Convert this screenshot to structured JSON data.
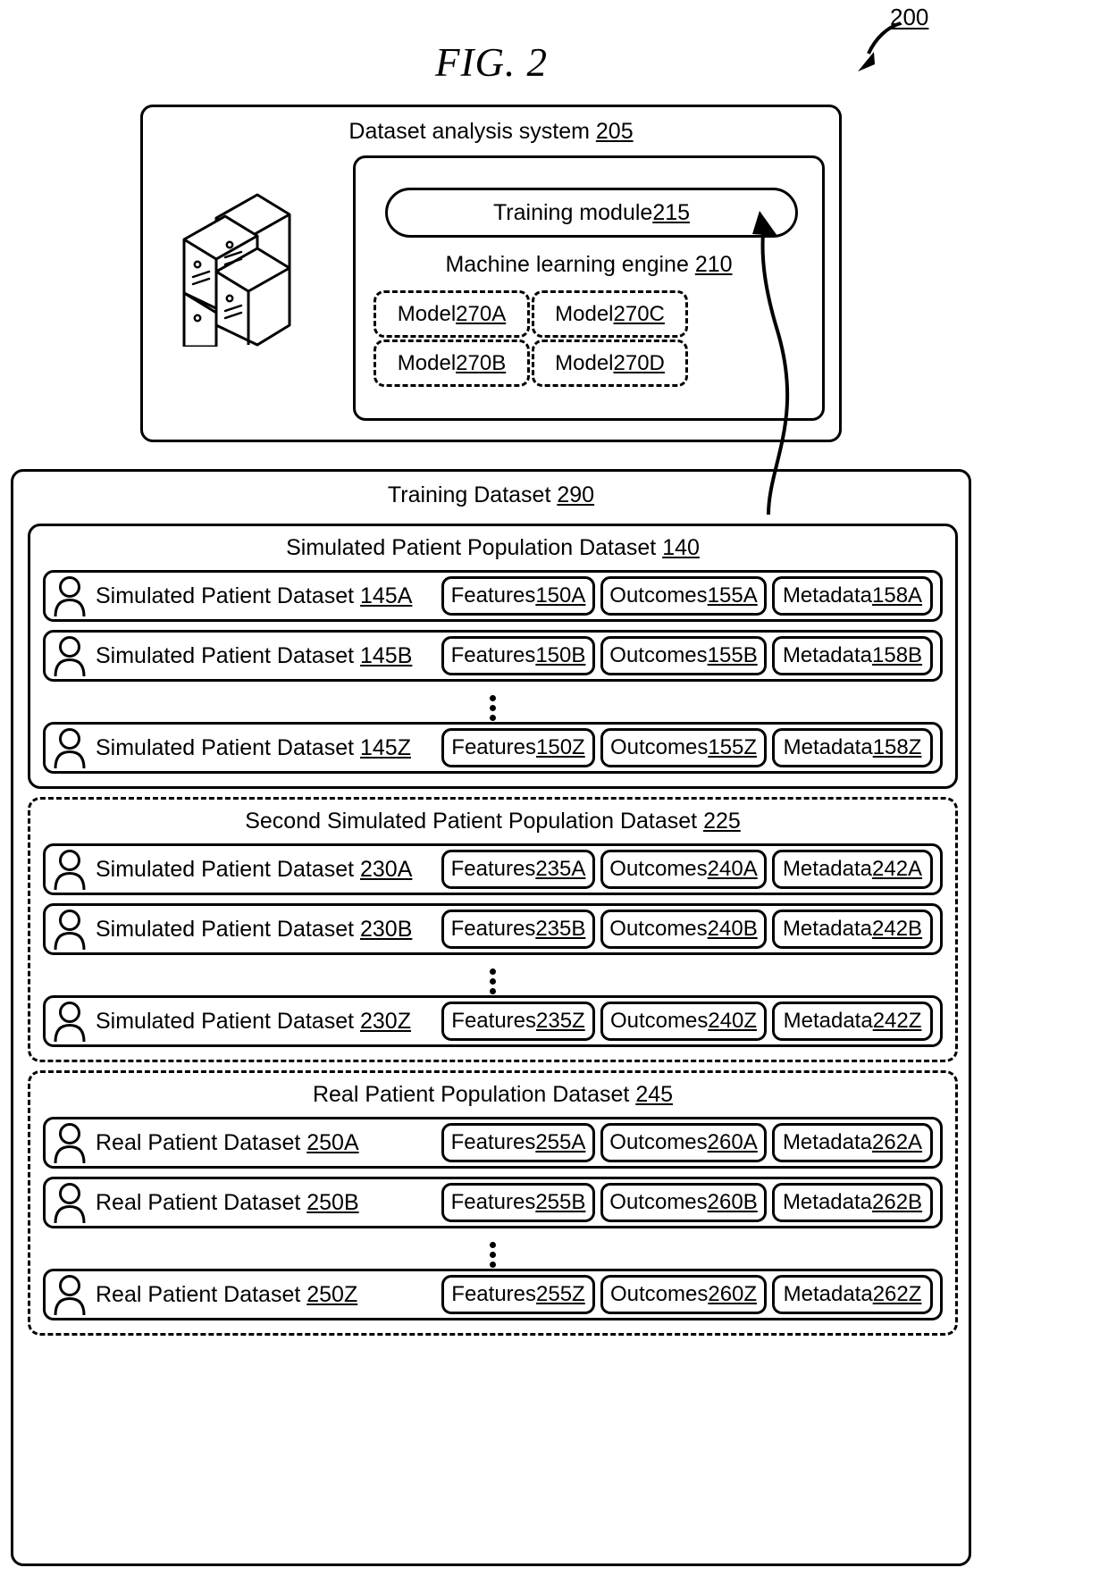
{
  "figure": {
    "title": "FIG. 2",
    "callout_label": "200",
    "callout_icon": "curved-arrow-icon"
  },
  "system": {
    "title_text": "Dataset analysis system ",
    "title_ref": "205",
    "server_icon": "server-stack-icon",
    "ml_engine": {
      "label_text": "Machine learning engine ",
      "label_ref": "210",
      "training_module": {
        "text": "Training module ",
        "ref": "215"
      },
      "models": [
        {
          "text": "Model ",
          "ref": "270A"
        },
        {
          "text": "Model ",
          "ref": "270C"
        },
        {
          "text": "Model ",
          "ref": "270B"
        },
        {
          "text": "Model ",
          "ref": "270D"
        }
      ]
    }
  },
  "training_dataset": {
    "title_text": "Training Dataset ",
    "title_ref": "290",
    "columns": [
      "Features",
      "Outcomes",
      "Metadata"
    ],
    "sections": [
      {
        "id": "simulated-patient-population-dataset",
        "border": "solid",
        "title_text": "Simulated Patient Population Dataset ",
        "title_ref": "140",
        "rows": [
          {
            "icon": "person-icon",
            "label_text": "Simulated Patient Dataset ",
            "label_ref": "145A",
            "features_text": "Features ",
            "features_ref": "150A",
            "outcomes_text": "Outcomes ",
            "outcomes_ref": "155A",
            "metadata_text": "Metadata ",
            "metadata_ref": "158A"
          },
          {
            "icon": "person-icon",
            "label_text": "Simulated Patient Dataset ",
            "label_ref": "145B",
            "features_text": "Features ",
            "features_ref": "150B",
            "outcomes_text": "Outcomes ",
            "outcomes_ref": "155B",
            "metadata_text": "Metadata ",
            "metadata_ref": "158B"
          },
          {
            "icon": "person-icon",
            "label_text": "Simulated Patient Dataset ",
            "label_ref": "145Z",
            "features_text": "Features ",
            "features_ref": "150Z",
            "outcomes_text": "Outcomes ",
            "outcomes_ref": "155Z",
            "metadata_text": "Metadata ",
            "metadata_ref": "158Z"
          }
        ]
      },
      {
        "id": "second-simulated-patient-population-dataset",
        "border": "dashed",
        "title_text": "Second Simulated Patient Population Dataset ",
        "title_ref": "225",
        "rows": [
          {
            "icon": "person-icon",
            "label_text": "Simulated Patient Dataset ",
            "label_ref": "230A",
            "features_text": "Features ",
            "features_ref": "235A",
            "outcomes_text": "Outcomes ",
            "outcomes_ref": "240A",
            "metadata_text": "Metadata ",
            "metadata_ref": "242A"
          },
          {
            "icon": "person-icon",
            "label_text": "Simulated Patient Dataset ",
            "label_ref": "230B",
            "features_text": "Features ",
            "features_ref": "235B",
            "outcomes_text": "Outcomes ",
            "outcomes_ref": "240B",
            "metadata_text": "Metadata ",
            "metadata_ref": "242B"
          },
          {
            "icon": "person-icon",
            "label_text": "Simulated Patient Dataset ",
            "label_ref": "230Z",
            "features_text": "Features ",
            "features_ref": "235Z",
            "outcomes_text": "Outcomes ",
            "outcomes_ref": "240Z",
            "metadata_text": "Metadata ",
            "metadata_ref": "242Z"
          }
        ]
      },
      {
        "id": "real-patient-population-dataset",
        "border": "dashed",
        "title_text": "Real Patient Population Dataset ",
        "title_ref": "245",
        "rows": [
          {
            "icon": "person-icon",
            "label_text": "Real Patient Dataset ",
            "label_ref": "250A",
            "features_text": "Features ",
            "features_ref": "255A",
            "outcomes_text": "Outcomes ",
            "outcomes_ref": "260A",
            "metadata_text": "Metadata ",
            "metadata_ref": "262A"
          },
          {
            "icon": "person-icon",
            "label_text": "Real Patient Dataset ",
            "label_ref": "250B",
            "features_text": "Features ",
            "features_ref": "255B",
            "outcomes_text": "Outcomes ",
            "outcomes_ref": "260B",
            "metadata_text": "Metadata ",
            "metadata_ref": "262B"
          },
          {
            "icon": "person-icon",
            "label_text": "Real Patient Dataset ",
            "label_ref": "250Z",
            "features_text": "Features ",
            "features_ref": "255Z",
            "outcomes_text": "Outcomes ",
            "outcomes_ref": "260Z",
            "metadata_text": "Metadata ",
            "metadata_ref": "262Z"
          }
        ]
      }
    ]
  },
  "colors": {
    "ink": "#000000",
    "background": "#ffffff"
  }
}
